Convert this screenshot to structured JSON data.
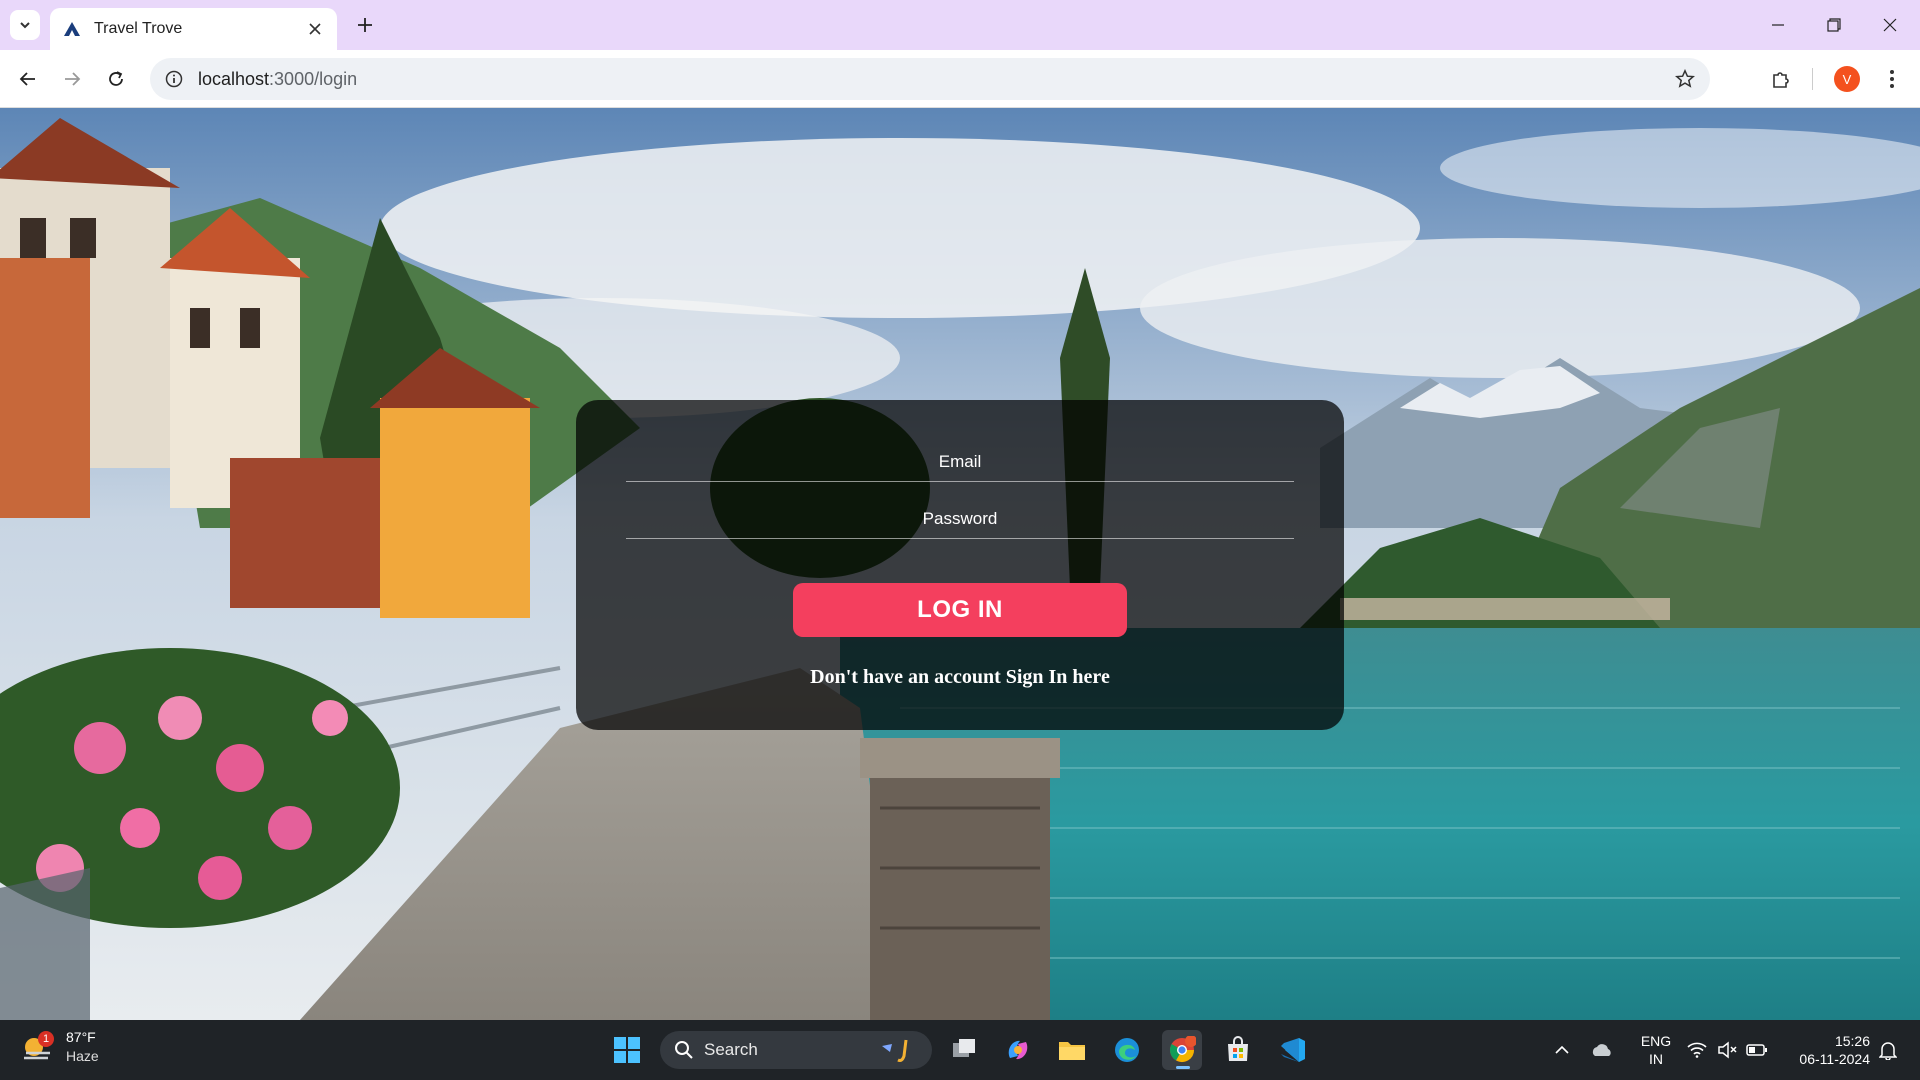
{
  "browser": {
    "tab_title": "Travel Trove",
    "url_host": "localhost",
    "url_rest": ":3000/login",
    "profile_initial": "V"
  },
  "login": {
    "email_placeholder": "Email",
    "password_placeholder": "Password",
    "login_label": "LOG IN",
    "signup_text": "Don't have an account Sign In here"
  },
  "taskbar": {
    "weather_temp": "87°F",
    "weather_desc": "Haze",
    "weather_badge": "1",
    "search_label": "Search",
    "lang_line1": "ENG",
    "lang_line2": "IN",
    "time": "15:26",
    "date": "06-11-2024"
  },
  "colors": {
    "tabbar": "#e9d8fa",
    "login_button": "#f43f5e",
    "taskbar": "#1f2327"
  }
}
